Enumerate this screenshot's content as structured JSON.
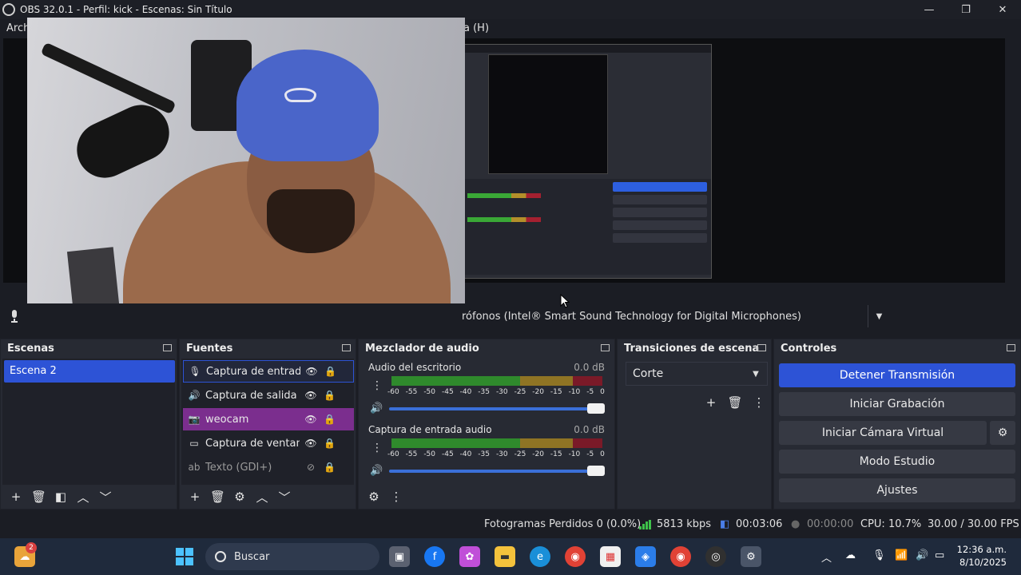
{
  "window": {
    "title": "OBS 32.0.1 - Perfil: kick - Escenas: Sin Título",
    "minimize": "—",
    "maximize": "❐",
    "close": "✕"
  },
  "menu": {
    "items": [
      "Arch",
      "a (H)"
    ]
  },
  "audio_device": {
    "label": "rófonos (Intel® Smart Sound Technology for Digital Microphones)"
  },
  "preview_inner": {
    "buttons": [
      "Detener Transmisión",
      "Iniciar Grabación",
      "Iniciar Cámara Virtual",
      "Modo Estudio",
      "Ajustes"
    ]
  },
  "scenes": {
    "title": "Escenas",
    "items": [
      {
        "label": "Escena 2",
        "selected": true
      }
    ]
  },
  "sources": {
    "title": "Fuentes",
    "items": [
      {
        "label": "Captura de entrada",
        "icon": "microphone-icon",
        "state": "selected"
      },
      {
        "label": "Captura de salida d",
        "icon": "speaker-icon",
        "state": "normal"
      },
      {
        "label": "weocam",
        "icon": "camera-icon",
        "state": "highlighted"
      },
      {
        "label": "Captura de ventana",
        "icon": "window-icon",
        "state": "normal"
      },
      {
        "label": "Texto (GDI+)",
        "icon": "text-icon",
        "state": "hidden"
      }
    ]
  },
  "mixer": {
    "title": "Mezclador de audio",
    "ticks": [
      "-60",
      "-55",
      "-50",
      "-45",
      "-40",
      "-35",
      "-30",
      "-25",
      "-20",
      "-15",
      "-10",
      "-5",
      "0"
    ],
    "channels": [
      {
        "name": "Audio del escritorio",
        "db": "0.0 dB",
        "volume": 1.0
      },
      {
        "name": "Captura de entrada audio",
        "db": "0.0 dB",
        "volume": 1.0
      }
    ]
  },
  "transitions": {
    "title": "Transiciones de escena",
    "selected": "Corte"
  },
  "controls": {
    "title": "Controles",
    "stop_stream": "Detener Transmisión",
    "start_recording": "Iniciar Grabación",
    "start_virtual_cam": "Iniciar Cámara Virtual",
    "studio_mode": "Modo Estudio",
    "settings": "Ajustes"
  },
  "status": {
    "dropped_frames": "Fotogramas Perdidos 0 (0.0%)",
    "bitrate": "5813 kbps",
    "stream_time": "00:03:06",
    "record_time": "00:00:00",
    "cpu": "CPU: 10.7%",
    "fps": "30.00 / 30.00 FPS"
  },
  "taskbar": {
    "search_placeholder": "Buscar",
    "time": "12:36 a.m.",
    "date": "8/10/2025",
    "weather_badge": "2"
  },
  "colors": {
    "accent_blue": "#2d53d6",
    "source_purple": "#7b2e8e",
    "meter_green": "#2f8a2c",
    "meter_yellow": "#8f7424",
    "meter_red": "#7a1a28",
    "dock_bg": "#272a33",
    "taskbar_bg": "#1f2a3c"
  }
}
